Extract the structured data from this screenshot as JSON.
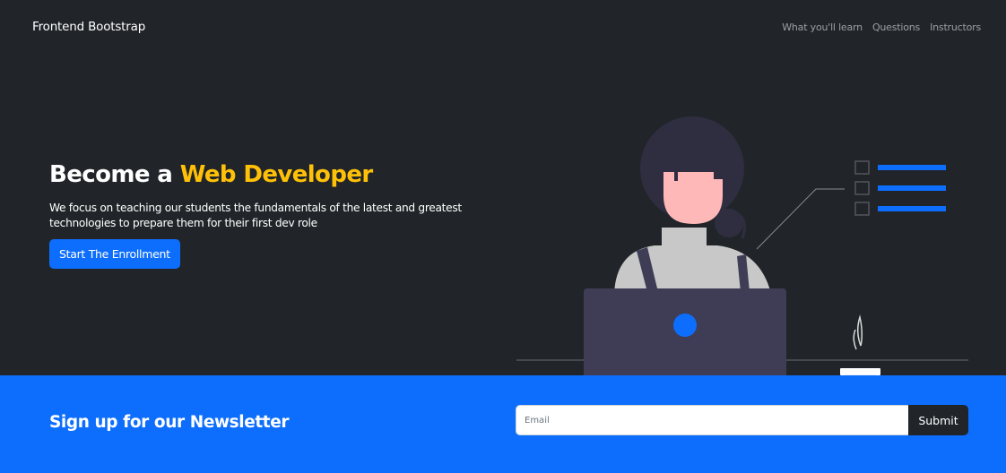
{
  "navbar": {
    "brand": "Frontend Bootstrap",
    "links": [
      "What you'll learn",
      "Questions",
      "Instructors"
    ]
  },
  "hero": {
    "title_prefix": "Become a ",
    "title_accent": "Web Developer",
    "lead": "We focus on teaching our students the fundamentals of the latest and greatest technologies to prepare them for their first dev role",
    "cta_label": "Start The Enrollment"
  },
  "newsletter": {
    "title": "Sign up for our Newsletter",
    "email_placeholder": "Email",
    "submit_label": "Submit"
  },
  "colors": {
    "background": "#212529",
    "primary": "#0d6efd",
    "accent": "#ffc107",
    "laptop": "#3f3d56"
  }
}
